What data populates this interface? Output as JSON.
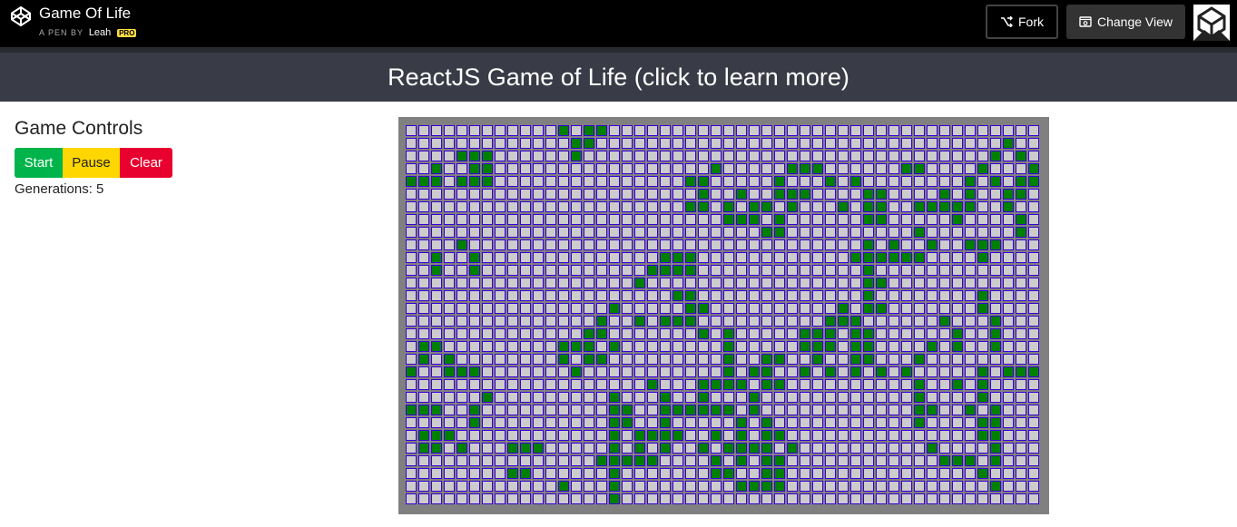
{
  "codepen": {
    "title": "Game Of Life",
    "byline_prefix": "A PEN BY",
    "author": "Leah",
    "badge": "PRO",
    "fork_label": "Fork",
    "change_view_label": "Change View"
  },
  "header": {
    "title": "ReactJS Game of Life (click to learn more)"
  },
  "controls": {
    "heading": "Game Controls",
    "start_label": "Start",
    "pause_label": "Pause",
    "clear_label": "Clear",
    "generations_label": "Generations: 5"
  },
  "board": {
    "cols": 50,
    "rows": 30,
    "colors": {
      "alive": "#008000",
      "dead": "#cccccc",
      "border": "#3a00d6",
      "background": "#808080"
    },
    "alive": [
      [
        0,
        12
      ],
      [
        0,
        14
      ],
      [
        0,
        15
      ],
      [
        1,
        13
      ],
      [
        1,
        14
      ],
      [
        1,
        47
      ],
      [
        2,
        4
      ],
      [
        2,
        5
      ],
      [
        2,
        6
      ],
      [
        2,
        13
      ],
      [
        2,
        46
      ],
      [
        2,
        48
      ],
      [
        3,
        2
      ],
      [
        3,
        5
      ],
      [
        3,
        6
      ],
      [
        3,
        24
      ],
      [
        3,
        30
      ],
      [
        3,
        31
      ],
      [
        3,
        32
      ],
      [
        3,
        39
      ],
      [
        3,
        40
      ],
      [
        3,
        45
      ],
      [
        3,
        49
      ],
      [
        4,
        0
      ],
      [
        4,
        1
      ],
      [
        4,
        2
      ],
      [
        4,
        4
      ],
      [
        4,
        5
      ],
      [
        4,
        6
      ],
      [
        4,
        22
      ],
      [
        4,
        23
      ],
      [
        4,
        29
      ],
      [
        4,
        33
      ],
      [
        4,
        35
      ],
      [
        4,
        44
      ],
      [
        4,
        46
      ],
      [
        4,
        48
      ],
      [
        4,
        49
      ],
      [
        5,
        23
      ],
      [
        5,
        26
      ],
      [
        5,
        29
      ],
      [
        5,
        30
      ],
      [
        5,
        31
      ],
      [
        5,
        36
      ],
      [
        5,
        37
      ],
      [
        5,
        42
      ],
      [
        5,
        44
      ],
      [
        5,
        47
      ],
      [
        5,
        48
      ],
      [
        6,
        22
      ],
      [
        6,
        23
      ],
      [
        6,
        25
      ],
      [
        6,
        27
      ],
      [
        6,
        28
      ],
      [
        6,
        30
      ],
      [
        6,
        34
      ],
      [
        6,
        36
      ],
      [
        6,
        37
      ],
      [
        6,
        40
      ],
      [
        6,
        41
      ],
      [
        6,
        42
      ],
      [
        6,
        43
      ],
      [
        6,
        44
      ],
      [
        6,
        47
      ],
      [
        7,
        25
      ],
      [
        7,
        26
      ],
      [
        7,
        27
      ],
      [
        7,
        29
      ],
      [
        7,
        36
      ],
      [
        7,
        37
      ],
      [
        7,
        43
      ],
      [
        7,
        48
      ],
      [
        8,
        28
      ],
      [
        8,
        29
      ],
      [
        8,
        40
      ],
      [
        8,
        48
      ],
      [
        9,
        4
      ],
      [
        9,
        36
      ],
      [
        9,
        38
      ],
      [
        9,
        41
      ],
      [
        9,
        44
      ],
      [
        9,
        45
      ],
      [
        9,
        46
      ],
      [
        10,
        2
      ],
      [
        10,
        5
      ],
      [
        10,
        20
      ],
      [
        10,
        21
      ],
      [
        10,
        22
      ],
      [
        10,
        35
      ],
      [
        10,
        36
      ],
      [
        10,
        37
      ],
      [
        10,
        38
      ],
      [
        10,
        39
      ],
      [
        10,
        40
      ],
      [
        10,
        45
      ],
      [
        11,
        2
      ],
      [
        11,
        5
      ],
      [
        11,
        19
      ],
      [
        11,
        20
      ],
      [
        11,
        21
      ],
      [
        11,
        22
      ],
      [
        11,
        36
      ],
      [
        12,
        18
      ],
      [
        12,
        36
      ],
      [
        12,
        37
      ],
      [
        13,
        21
      ],
      [
        13,
        22
      ],
      [
        13,
        36
      ],
      [
        13,
        45
      ],
      [
        14,
        16
      ],
      [
        14,
        22
      ],
      [
        14,
        23
      ],
      [
        14,
        34
      ],
      [
        14,
        36
      ],
      [
        14,
        37
      ],
      [
        14,
        45
      ],
      [
        15,
        15
      ],
      [
        15,
        18
      ],
      [
        15,
        20
      ],
      [
        15,
        21
      ],
      [
        15,
        22
      ],
      [
        15,
        33
      ],
      [
        15,
        34
      ],
      [
        15,
        35
      ],
      [
        15,
        42
      ],
      [
        15,
        46
      ],
      [
        16,
        14
      ],
      [
        16,
        15
      ],
      [
        16,
        23
      ],
      [
        16,
        25
      ],
      [
        16,
        31
      ],
      [
        16,
        32
      ],
      [
        16,
        33
      ],
      [
        16,
        35
      ],
      [
        16,
        36
      ],
      [
        16,
        43
      ],
      [
        16,
        46
      ],
      [
        17,
        1
      ],
      [
        17,
        2
      ],
      [
        17,
        12
      ],
      [
        17,
        13
      ],
      [
        17,
        14
      ],
      [
        17,
        16
      ],
      [
        17,
        25
      ],
      [
        17,
        31
      ],
      [
        17,
        32
      ],
      [
        17,
        33
      ],
      [
        17,
        35
      ],
      [
        17,
        36
      ],
      [
        17,
        41
      ],
      [
        17,
        43
      ],
      [
        17,
        46
      ],
      [
        18,
        1
      ],
      [
        18,
        3
      ],
      [
        18,
        12
      ],
      [
        18,
        14
      ],
      [
        18,
        15
      ],
      [
        18,
        25
      ],
      [
        18,
        28
      ],
      [
        18,
        29
      ],
      [
        18,
        32
      ],
      [
        18,
        35
      ],
      [
        18,
        36
      ],
      [
        18,
        40
      ],
      [
        19,
        0
      ],
      [
        19,
        3
      ],
      [
        19,
        4
      ],
      [
        19,
        5
      ],
      [
        19,
        13
      ],
      [
        19,
        25
      ],
      [
        19,
        27
      ],
      [
        19,
        28
      ],
      [
        19,
        31
      ],
      [
        19,
        33
      ],
      [
        19,
        35
      ],
      [
        19,
        37
      ],
      [
        19,
        39
      ],
      [
        19,
        45
      ],
      [
        19,
        47
      ],
      [
        19,
        48
      ],
      [
        19,
        49
      ],
      [
        20,
        19
      ],
      [
        20,
        23
      ],
      [
        20,
        24
      ],
      [
        20,
        25
      ],
      [
        20,
        26
      ],
      [
        20,
        28
      ],
      [
        20,
        29
      ],
      [
        20,
        40
      ],
      [
        20,
        43
      ],
      [
        20,
        45
      ],
      [
        21,
        6
      ],
      [
        21,
        16
      ],
      [
        21,
        20
      ],
      [
        21,
        23
      ],
      [
        21,
        27
      ],
      [
        21,
        40
      ],
      [
        21,
        45
      ],
      [
        22,
        0
      ],
      [
        22,
        1
      ],
      [
        22,
        2
      ],
      [
        22,
        5
      ],
      [
        22,
        16
      ],
      [
        22,
        17
      ],
      [
        22,
        20
      ],
      [
        22,
        21
      ],
      [
        22,
        22
      ],
      [
        22,
        23
      ],
      [
        22,
        24
      ],
      [
        22,
        25
      ],
      [
        22,
        27
      ],
      [
        22,
        40
      ],
      [
        22,
        41
      ],
      [
        22,
        44
      ],
      [
        22,
        46
      ],
      [
        23,
        5
      ],
      [
        23,
        16
      ],
      [
        23,
        17
      ],
      [
        23,
        20
      ],
      [
        23,
        26
      ],
      [
        23,
        28
      ],
      [
        23,
        40
      ],
      [
        23,
        45
      ],
      [
        23,
        46
      ],
      [
        24,
        1
      ],
      [
        24,
        2
      ],
      [
        24,
        3
      ],
      [
        24,
        16
      ],
      [
        24,
        18
      ],
      [
        24,
        19
      ],
      [
        24,
        20
      ],
      [
        24,
        21
      ],
      [
        24,
        24
      ],
      [
        24,
        26
      ],
      [
        24,
        28
      ],
      [
        24,
        29
      ],
      [
        24,
        45
      ],
      [
        24,
        46
      ],
      [
        25,
        1
      ],
      [
        25,
        2
      ],
      [
        25,
        4
      ],
      [
        25,
        8
      ],
      [
        25,
        9
      ],
      [
        25,
        10
      ],
      [
        25,
        16
      ],
      [
        25,
        18
      ],
      [
        25,
        20
      ],
      [
        25,
        23
      ],
      [
        25,
        25
      ],
      [
        25,
        26
      ],
      [
        25,
        27
      ],
      [
        25,
        28
      ],
      [
        25,
        30
      ],
      [
        25,
        41
      ],
      [
        25,
        46
      ],
      [
        26,
        15
      ],
      [
        26,
        16
      ],
      [
        26,
        17
      ],
      [
        26,
        18
      ],
      [
        26,
        19
      ],
      [
        26,
        24
      ],
      [
        26,
        26
      ],
      [
        26,
        28
      ],
      [
        26,
        29
      ],
      [
        26,
        42
      ],
      [
        26,
        43
      ],
      [
        26,
        44
      ],
      [
        26,
        46
      ],
      [
        27,
        8
      ],
      [
        27,
        9
      ],
      [
        27,
        16
      ],
      [
        27,
        24
      ],
      [
        27,
        25
      ],
      [
        27,
        28
      ],
      [
        27,
        29
      ],
      [
        27,
        45
      ],
      [
        28,
        12
      ],
      [
        28,
        16
      ],
      [
        28,
        26
      ],
      [
        28,
        27
      ],
      [
        28,
        28
      ],
      [
        28,
        29
      ],
      [
        28,
        46
      ],
      [
        29,
        16
      ]
    ]
  }
}
